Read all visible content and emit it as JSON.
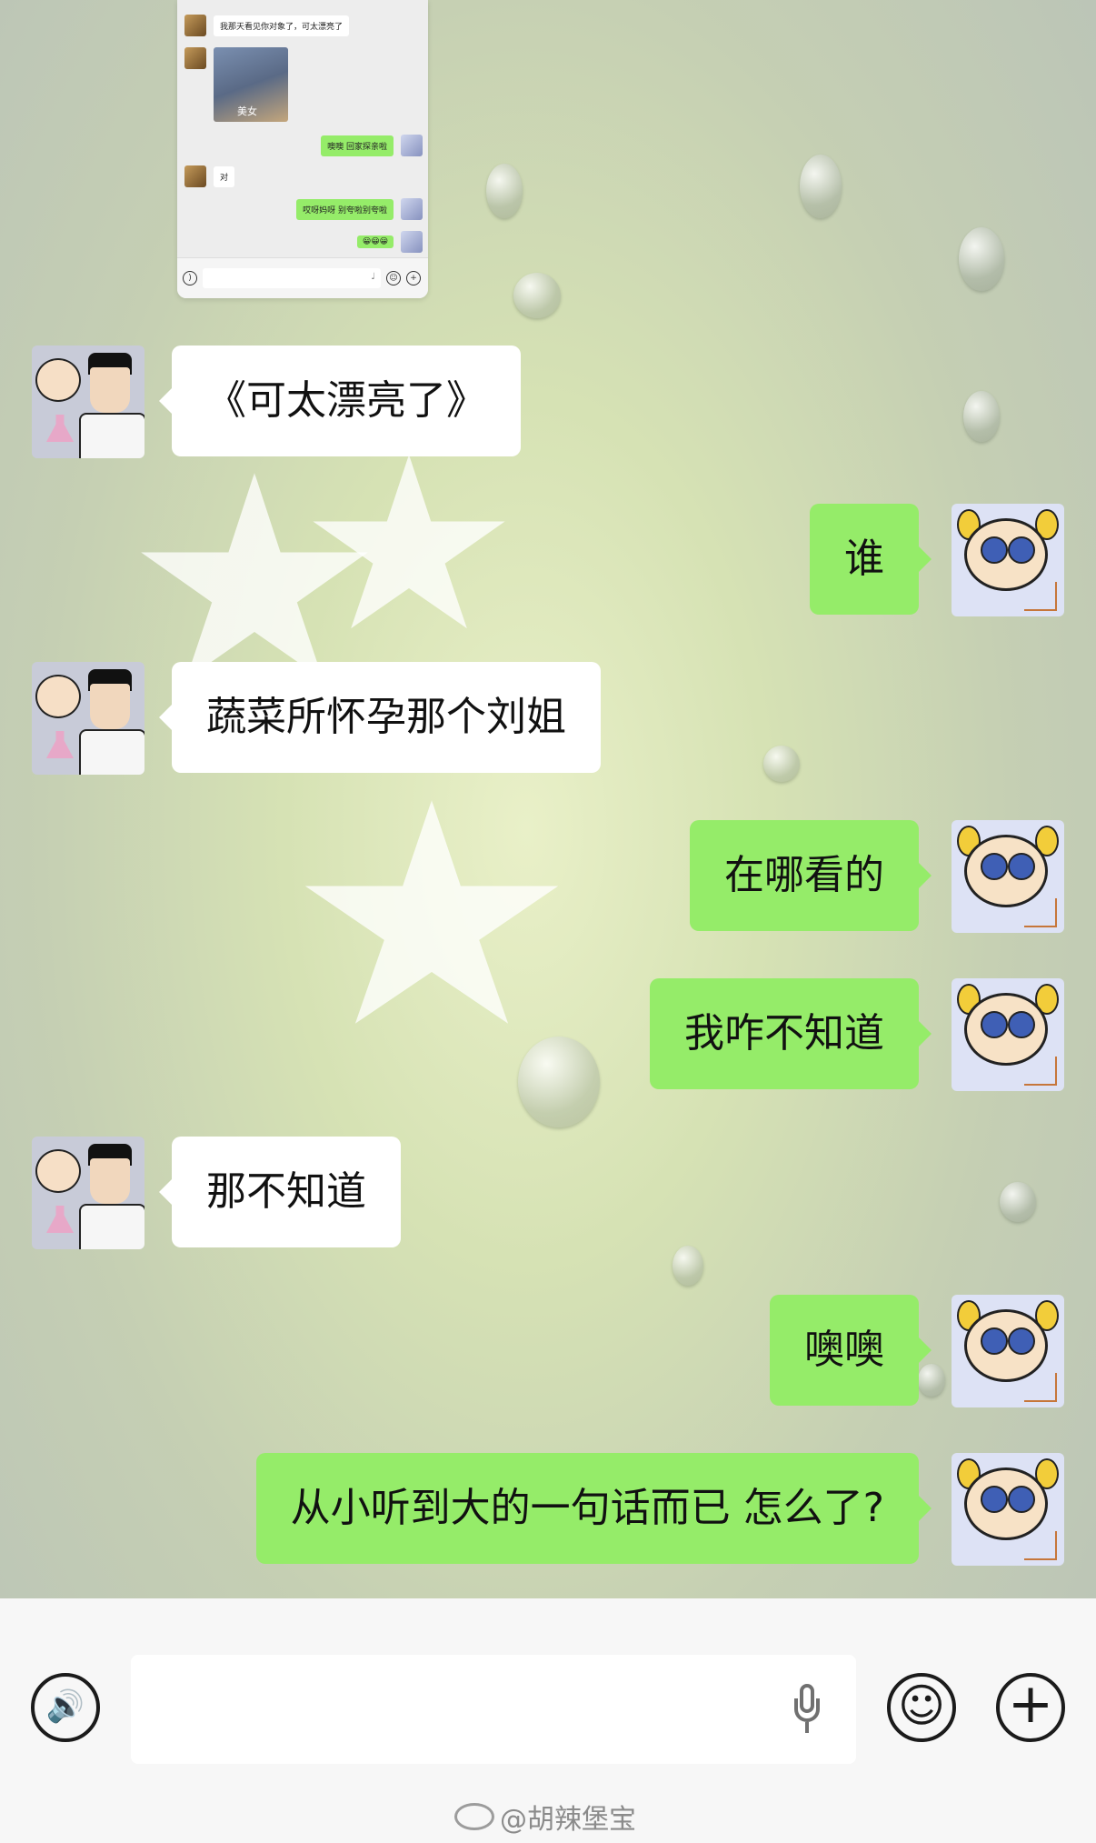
{
  "embedded_screenshot": {
    "messages": [
      {
        "side": "left",
        "text": "我那天看见你对象了，可太漂亮了"
      },
      {
        "side": "left",
        "image_caption": "美女"
      },
      {
        "side": "right",
        "text": "噢噢 回家探亲啦"
      },
      {
        "side": "left",
        "text": "对"
      },
      {
        "side": "right",
        "text": "哎呀妈呀 别夸啦别夸啦"
      },
      {
        "side": "right",
        "text": "😀😀😀"
      }
    ]
  },
  "messages": [
    {
      "side": "left",
      "text": "《可太漂亮了》"
    },
    {
      "side": "right",
      "text": "谁"
    },
    {
      "side": "left",
      "text": "蔬菜所怀孕那个刘姐"
    },
    {
      "side": "right",
      "text": "在哪看的"
    },
    {
      "side": "right",
      "text": "我咋不知道"
    },
    {
      "side": "left",
      "text": "那不知道"
    },
    {
      "side": "right",
      "text": "噢噢"
    },
    {
      "side": "right",
      "text": "从小听到大的一句话而已 怎么了?"
    }
  ],
  "input_bar": {
    "voice_icon": "voice-icon",
    "mic_icon": "microphone-icon",
    "emoji_icon": "emoji-icon",
    "plus_icon": "plus-icon",
    "voice_glyph": "🔊",
    "emoji_glyph": "☺",
    "plus_glyph": "+"
  },
  "watermark": "@胡辣堡宝",
  "colors": {
    "sent_bubble": "#95ec69",
    "received_bubble": "#ffffff",
    "input_bar": "#f7f7f7"
  }
}
